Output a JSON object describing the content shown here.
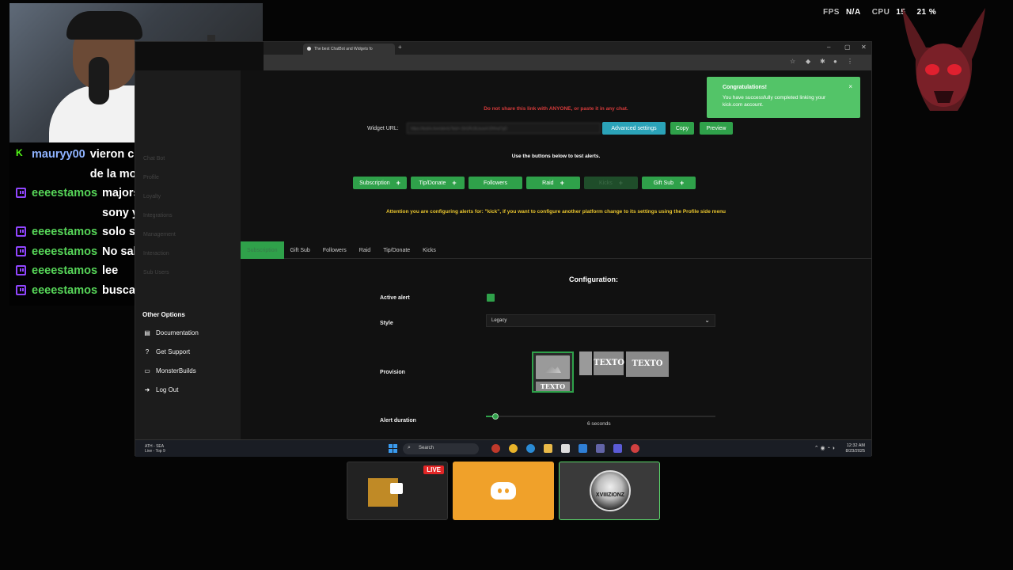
{
  "overlay": {
    "stats": [
      {
        "label": "FPS",
        "value": "N/A"
      },
      {
        "label": "CPU",
        "value": "15"
      },
      {
        "label": "",
        "value": "21 %"
      }
    ]
  },
  "chat": [
    {
      "platform": "kick",
      "user": "mauryy00",
      "user_color": "#8fb3ff",
      "message": "vieron como claren se caeo de la moto dale para atras"
    },
    {
      "platform": "twitch",
      "user": "eeeestamos",
      "user_color": "#57d659",
      "message": "majors se llama warner, sony y umg"
    },
    {
      "platform": "twitch",
      "user": "eeeestamos",
      "user_color": "#57d659",
      "message": "solo son las tres grandes"
    },
    {
      "platform": "twitch",
      "user": "eeeestamos",
      "user_color": "#57d659",
      "message": "No sabías eso Omar?"
    },
    {
      "platform": "twitch",
      "user": "eeeestamos",
      "user_color": "#57d659",
      "message": "lee"
    },
    {
      "platform": "twitch",
      "user": "eeeestamos",
      "user_color": "#57d659",
      "message": "busca majors"
    }
  ],
  "browser": {
    "tab_title": "The best ChatBot and Widgets fo",
    "new_tab": "+",
    "minimize": "–",
    "maximize": "▢",
    "close": "✕"
  },
  "sidebar": {
    "faded_items": [
      "Chat Bot",
      "Profile",
      "Loyalty",
      "Integrations",
      "Management",
      "Interaction",
      "Sub Users"
    ],
    "other_options_title": "Other Options",
    "items": [
      {
        "label": "Documentation",
        "icon": "document-icon"
      },
      {
        "label": "Get Support",
        "icon": "help-icon"
      },
      {
        "label": "MonsterBuilds",
        "icon": "monitor-icon"
      },
      {
        "label": "Log Out",
        "icon": "logout-icon"
      }
    ]
  },
  "main": {
    "warning": "Do not share this link with ANYONE, or paste it in any chat.",
    "widget_url_label": "Widget URL:",
    "widget_url_value": "https://botrix.live/alerts?bid=-2bGRLBLbuwXJ0Hnd7gD",
    "advanced_settings": "Advanced settings",
    "copy": "Copy",
    "preview": "Preview",
    "use_buttons_text": "Use the buttons below to test alerts.",
    "test_buttons": [
      {
        "label": "Subscription",
        "plus": "+",
        "dim": false
      },
      {
        "label": "Tip/Donate",
        "plus": "+",
        "dim": false
      },
      {
        "label": "Followers",
        "plus": "",
        "dim": false
      },
      {
        "label": "Raid",
        "plus": "+",
        "dim": false
      },
      {
        "label": "Kicks",
        "plus": "+",
        "dim": true
      },
      {
        "label": "Gift Sub",
        "plus": "+",
        "dim": false
      }
    ],
    "attention": "Attention you are configuring alerts for: \"kick\", if you want to configure another platform change to its settings using the Profile side menu",
    "tabs": [
      "Subscription",
      "Gift Sub",
      "Followers",
      "Raid",
      "Tip/Donate",
      "Kicks"
    ],
    "active_tab": "Subscription",
    "config_title": "Configuration:",
    "active_alert_label": "Active alert",
    "active_alert_checked": true,
    "style_label": "Style",
    "style_value": "Legacy",
    "provision_label": "Provision",
    "provision_texto": "TEXTO",
    "alert_duration_label": "Alert duration",
    "alert_duration_value": "6 seconds",
    "alert_duration_fraction": 0.04
  },
  "toast": {
    "title": "Congratulations!",
    "message": "You have successfully completed linking your kick.com account.",
    "close": "×"
  },
  "taskbar": {
    "weather_line1": "ATH - SEA",
    "weather_line2": "Live - Top 9",
    "search_placeholder": "Search",
    "time": "12:32 AM",
    "date": "8/23/2025"
  },
  "tiles": {
    "live_badge": "LIVE",
    "avatar_text": "XVIIIZIONZ"
  },
  "colors": {
    "accent_green": "#2fa14a",
    "warning_red": "#d63b3b",
    "attention_yellow": "#e9c52e",
    "discord_tile": "#f0a12a",
    "live_red": "#e22626"
  }
}
